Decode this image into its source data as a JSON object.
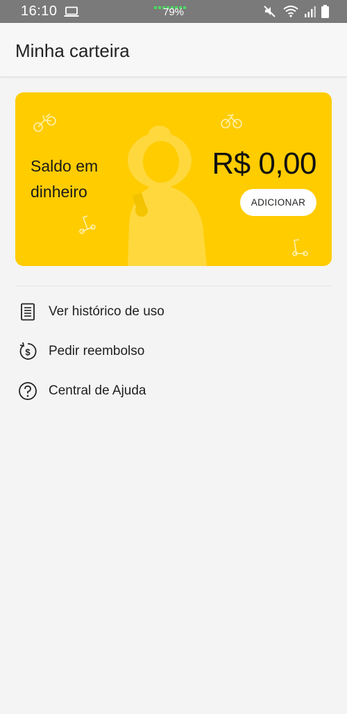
{
  "status_bar": {
    "time": "16:10",
    "battery_percent": "79%"
  },
  "header": {
    "title": "Minha carteira"
  },
  "wallet_card": {
    "label": "Saldo em dinheiro",
    "amount": "R$ 0,00",
    "add_button_label": "ADICIONAR",
    "background_color": "#ffcc00"
  },
  "menu": {
    "items": [
      {
        "label": "Ver histórico de uso",
        "icon": "receipt-icon"
      },
      {
        "label": "Pedir reembolso",
        "icon": "refund-icon"
      },
      {
        "label": "Central de Ajuda",
        "icon": "help-icon"
      }
    ]
  }
}
